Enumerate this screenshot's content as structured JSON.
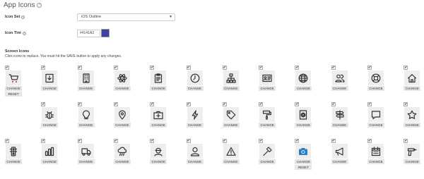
{
  "title": "App Icons",
  "icon_set": {
    "label": "Icon Set",
    "value": "iOS Outline"
  },
  "icon_tint": {
    "label": "Icon Tint",
    "value": "#4141A3",
    "color": "#4141A3"
  },
  "screen_icons": {
    "label": "Screen Icons",
    "hint": "Click icons to replace. You must hit the SAVE button to apply any changes.",
    "change_label": "CHANGE",
    "reset_label": "RESET",
    "check_mark": "✔",
    "rows": [
      [
        {
          "icon": "shopping-cart-icon",
          "has_reset": true,
          "color": "#d9232e"
        },
        {
          "icon": "download-icon"
        },
        {
          "icon": "building-icon"
        },
        {
          "icon": "atom-icon"
        },
        {
          "icon": "clipboard-icon"
        },
        {
          "icon": "clock-icon"
        },
        {
          "icon": "org-chart-icon"
        },
        {
          "icon": "contact-card-icon"
        },
        {
          "icon": "globe-icon"
        },
        {
          "icon": "users-icon"
        },
        {
          "icon": "lifebuoy-icon"
        },
        {
          "icon": "home-icon"
        }
      ],
      [
        {
          "icon": "bug-icon"
        },
        {
          "icon": "lightbulb-icon"
        },
        {
          "icon": "map-pin-icon"
        },
        {
          "icon": "first-aid-kit-icon"
        },
        {
          "icon": "lightning-icon"
        },
        {
          "icon": "tag-icon"
        },
        {
          "icon": "paint-roller-icon"
        },
        {
          "icon": "at-sign-icon"
        },
        {
          "icon": "signpost-icon"
        },
        {
          "icon": "chat-bubble-icon"
        },
        {
          "icon": "star-icon"
        }
      ],
      [
        {
          "icon": "traffic-light-icon"
        },
        {
          "icon": "bar-chart-icon"
        },
        {
          "icon": "truck-icon"
        },
        {
          "icon": "rain-cloud-icon"
        },
        {
          "icon": "worker-icon"
        },
        {
          "icon": "person-icon"
        },
        {
          "icon": "warning-icon"
        },
        {
          "icon": "hammer-icon"
        },
        {
          "icon": "camera-icon",
          "has_reset": true,
          "color": "#2a7fc0"
        },
        {
          "icon": "megaphone-icon"
        },
        {
          "icon": "calendar-icon"
        },
        {
          "icon": "drill-icon"
        }
      ]
    ]
  }
}
